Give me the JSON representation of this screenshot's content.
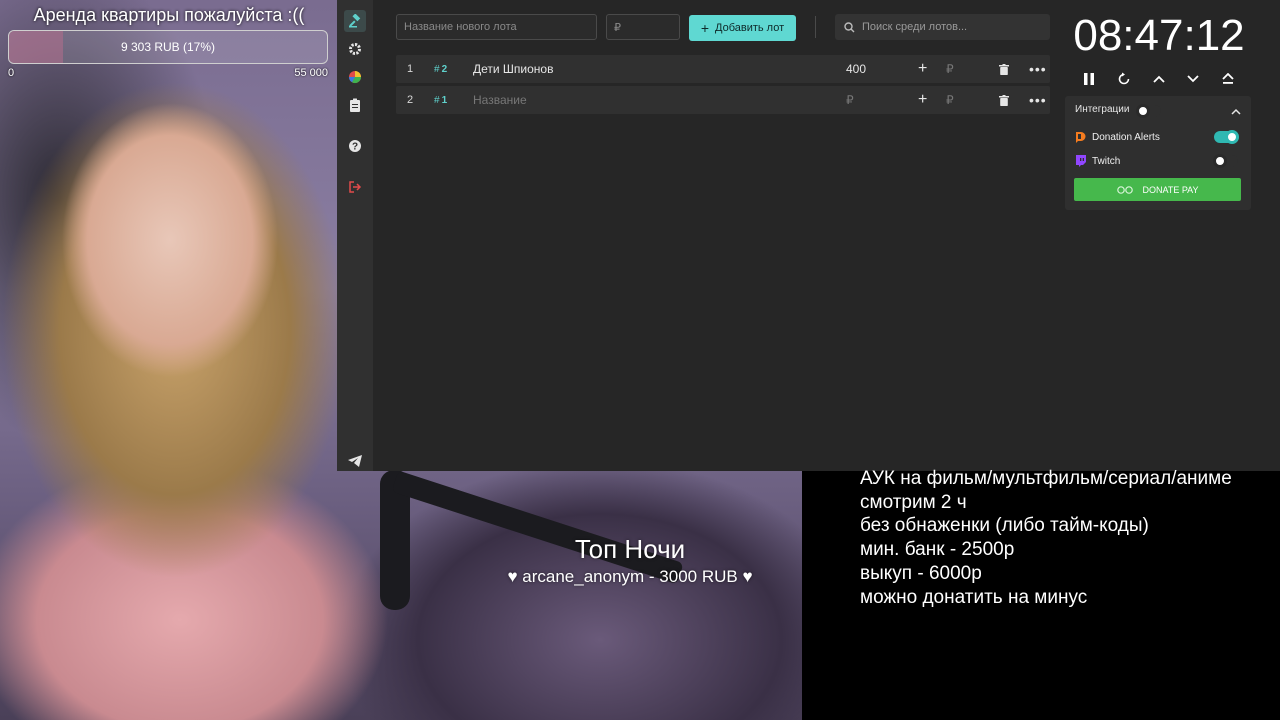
{
  "goal": {
    "title": "Аренда квартиры пожалуйста :((",
    "progress_label": "9 303 RUB (17%)",
    "progress_fraction": 0.17,
    "min": "0",
    "max": "55 000"
  },
  "sidebar": {
    "items": [
      {
        "name": "auction",
        "icon": "gavel-icon"
      },
      {
        "name": "settings",
        "icon": "gear-icon"
      },
      {
        "name": "stats",
        "icon": "pie-chart-icon"
      },
      {
        "name": "history",
        "icon": "clipboard-icon"
      },
      {
        "name": "help",
        "icon": "help-icon"
      },
      {
        "name": "logout",
        "icon": "logout-icon"
      },
      {
        "name": "telegram",
        "icon": "telegram-icon"
      }
    ]
  },
  "toolbar": {
    "lot_name_placeholder": "Название нового лота",
    "amount_placeholder": "₽",
    "add_lot_label": "Добавить лот",
    "search_placeholder": "Поиск среди лотов..."
  },
  "lots": [
    {
      "index": "1",
      "fast_id": "2",
      "name": "Дети Шпионов",
      "amount": "400",
      "add_placeholder": "₽"
    },
    {
      "index": "2",
      "fast_id": "1",
      "name": "Название",
      "amount": "₽",
      "add_placeholder": "₽"
    }
  ],
  "timer": {
    "value": "08:47:12"
  },
  "integrations": {
    "title": "Интеграции",
    "items": [
      {
        "label": "Donation Alerts",
        "enabled": true
      },
      {
        "label": "Twitch",
        "enabled": false
      }
    ],
    "donate_pay_label": "DONATE PAY"
  },
  "top_night": {
    "title": "Топ Ночи",
    "entry": "arcane_anonym - 3000 RUB"
  },
  "info_lines": [
    "АУК на фильм/мультфильм/сериал/аниме",
    "смотрим 2 ч",
    "без обнаженки (либо тайм-коды)",
    "мин. банк - 2500р",
    "выкуп - 6000р",
    "можно донатить на минус"
  ],
  "colors": {
    "accent": "#5fd8d2",
    "donate_pay": "#46b84c",
    "app_bg": "#262626",
    "row_bg": "#303030"
  }
}
